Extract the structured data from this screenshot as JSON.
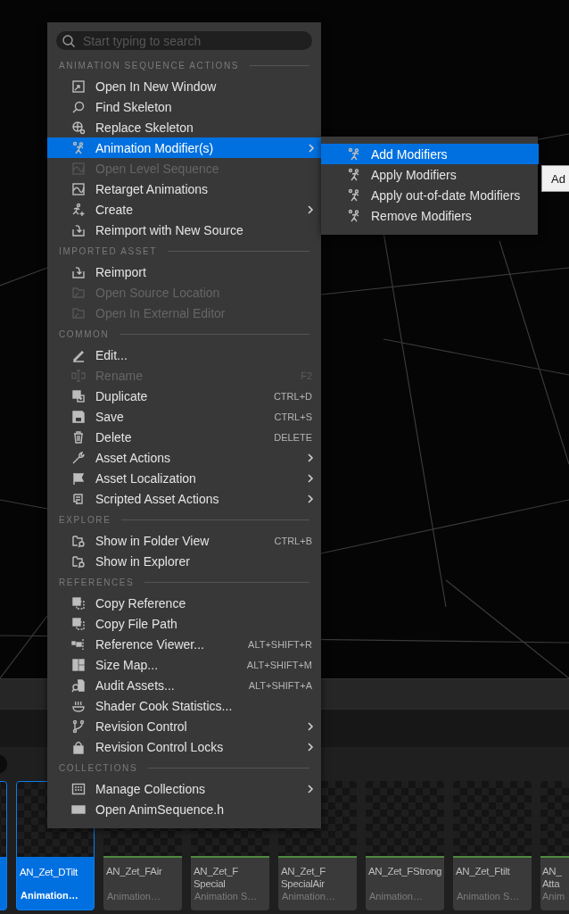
{
  "context_menu": {
    "search": {
      "placeholder": "Start typing to search"
    },
    "sections": [
      {
        "heading": "ANIMATION SEQUENCE ACTIONS",
        "items": [
          {
            "label": "Open In New Window",
            "disabled": false,
            "selected": false,
            "has_submenu": false
          },
          {
            "label": "Find Skeleton",
            "disabled": false,
            "selected": false,
            "has_submenu": false
          },
          {
            "label": "Replace Skeleton",
            "disabled": false,
            "selected": false,
            "has_submenu": false
          },
          {
            "label": "Animation Modifier(s)",
            "disabled": false,
            "selected": true,
            "has_submenu": true
          },
          {
            "label": "Open Level Sequence",
            "disabled": true,
            "selected": false,
            "has_submenu": false
          },
          {
            "label": "Retarget Animations",
            "disabled": false,
            "selected": false,
            "has_submenu": false
          },
          {
            "label": "Create",
            "disabled": false,
            "selected": false,
            "has_submenu": true
          },
          {
            "label": "Reimport with New Source",
            "disabled": false,
            "selected": false,
            "has_submenu": false
          }
        ]
      },
      {
        "heading": "IMPORTED ASSET",
        "items": [
          {
            "label": "Reimport",
            "disabled": false,
            "selected": false,
            "has_submenu": false
          },
          {
            "label": "Open Source Location",
            "disabled": true,
            "selected": false,
            "has_submenu": false
          },
          {
            "label": "Open In External Editor",
            "disabled": true,
            "selected": false,
            "has_submenu": false
          }
        ]
      },
      {
        "heading": "COMMON",
        "items": [
          {
            "label": "Edit...",
            "disabled": false,
            "selected": false,
            "has_submenu": false
          },
          {
            "label": "Rename",
            "shortcut": "F2",
            "disabled": true,
            "selected": false,
            "has_submenu": false
          },
          {
            "label": "Duplicate",
            "shortcut": "CTRL+D",
            "disabled": false,
            "selected": false,
            "has_submenu": false
          },
          {
            "label": "Save",
            "shortcut": "CTRL+S",
            "disabled": false,
            "selected": false,
            "has_submenu": false
          },
          {
            "label": "Delete",
            "shortcut": "DELETE",
            "disabled": false,
            "selected": false,
            "has_submenu": false
          },
          {
            "label": "Asset Actions",
            "disabled": false,
            "selected": false,
            "has_submenu": true
          },
          {
            "label": "Asset Localization",
            "disabled": false,
            "selected": false,
            "has_submenu": true
          },
          {
            "label": "Scripted Asset Actions",
            "disabled": false,
            "selected": false,
            "has_submenu": true
          }
        ]
      },
      {
        "heading": "EXPLORE",
        "items": [
          {
            "label": "Show in Folder View",
            "shortcut": "CTRL+B",
            "disabled": false,
            "selected": false,
            "has_submenu": false
          },
          {
            "label": "Show in Explorer",
            "disabled": false,
            "selected": false,
            "has_submenu": false
          }
        ]
      },
      {
        "heading": "REFERENCES",
        "items": [
          {
            "label": "Copy Reference",
            "disabled": false,
            "selected": false,
            "has_submenu": false
          },
          {
            "label": "Copy File Path",
            "disabled": false,
            "selected": false,
            "has_submenu": false
          },
          {
            "label": "Reference Viewer...",
            "shortcut": "ALT+SHIFT+R",
            "disabled": false,
            "selected": false,
            "has_submenu": false
          },
          {
            "label": "Size Map...",
            "shortcut": "ALT+SHIFT+M",
            "disabled": false,
            "selected": false,
            "has_submenu": false
          },
          {
            "label": "Audit Assets...",
            "shortcut": "ALT+SHIFT+A",
            "disabled": false,
            "selected": false,
            "has_submenu": false
          },
          {
            "label": "Shader Cook Statistics...",
            "disabled": false,
            "selected": false,
            "has_submenu": false
          },
          {
            "label": "Revision Control",
            "disabled": false,
            "selected": false,
            "has_submenu": true
          },
          {
            "label": "Revision Control Locks",
            "disabled": false,
            "selected": false,
            "has_submenu": true
          }
        ]
      },
      {
        "heading": "COLLECTIONS",
        "items": [
          {
            "label": "Manage Collections",
            "disabled": false,
            "selected": false,
            "has_submenu": true
          },
          {
            "label": "Open AnimSequence.h",
            "disabled": false,
            "selected": false,
            "has_submenu": false
          }
        ]
      }
    ]
  },
  "submenu": {
    "items": [
      {
        "label": "Add Modifiers",
        "selected": true
      },
      {
        "label": "Apply Modifiers",
        "selected": false
      },
      {
        "label": "Apply out-of-date Modifiers",
        "selected": false
      },
      {
        "label": "Remove Modifiers",
        "selected": false
      }
    ]
  },
  "tooltip": {
    "text": "Ad"
  },
  "content_browser": {
    "tiles": [
      {
        "selected": true
      },
      {
        "title": "AN_Zet_DTilt",
        "type": "Animation…",
        "selected": true
      },
      {
        "title": "AN_Zet_FAir",
        "type": "Animation…",
        "selected": false
      },
      {
        "title": "AN_Zet_F Special",
        "type": "Animation S…",
        "selected": false
      },
      {
        "title": "AN_Zet_F SpecialAir",
        "type": "Animation…",
        "selected": false
      },
      {
        "title": "AN_Zet_FStrong",
        "type": "Animation…",
        "selected": false
      },
      {
        "title": "AN_Zet_Ftilt",
        "type": "Animation S…",
        "selected": false
      },
      {
        "title": "AN_ Atta",
        "type": "Anim",
        "selected": false
      }
    ]
  }
}
